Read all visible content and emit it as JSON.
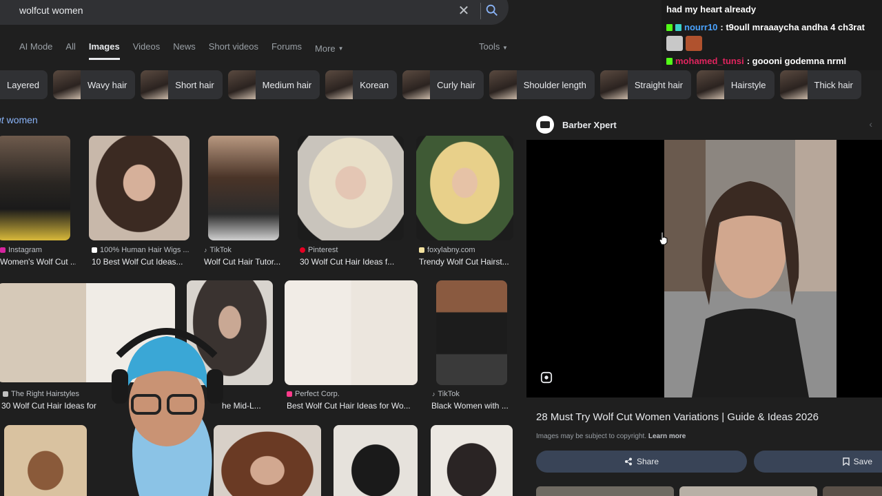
{
  "search": {
    "query": "wolfcut women"
  },
  "tabs": [
    {
      "label": "AI Mode"
    },
    {
      "label": "All"
    },
    {
      "label": "Images",
      "active": true
    },
    {
      "label": "Videos"
    },
    {
      "label": "News"
    },
    {
      "label": "Short videos"
    },
    {
      "label": "Forums"
    },
    {
      "label": "More"
    }
  ],
  "tools_label": "Tools",
  "chips": [
    "Layered",
    "Wavy hair",
    "Short hair",
    "Medium hair",
    "Korean",
    "Curly hair",
    "Shoulder length",
    "Straight hair",
    "Hairstyle",
    "Thick hair"
  ],
  "section": {
    "prefix": "ut",
    "suffix": " women"
  },
  "results_row1": [
    {
      "source": "Instagram",
      "caption": "Women's Wolf Cut ...",
      "fav": "#d6249f"
    },
    {
      "source": "100% Human Hair Wigs ...",
      "caption": "10 Best Wolf Cut Ideas...",
      "fav": "#ffffff"
    },
    {
      "source": "TikTok",
      "caption": "Wolf Cut Hair Tutor...",
      "fav": "#ffffff"
    },
    {
      "source": "Pinterest",
      "caption": "30 Wolf Cut Hair Ideas f...",
      "fav": "#e60023"
    },
    {
      "source": "foxylabny.com",
      "caption": "Trendy Wolf Cut Hairst...",
      "fav": "#f4e2a0"
    }
  ],
  "results_row2": [
    {
      "source": "The Right Hairstyles",
      "caption": "30 Wolf Cut Hair Ideas for",
      "fav": "#c0c0c0"
    },
    {
      "source": "",
      "caption": "he Mid-L...",
      "fav": ""
    },
    {
      "source": "Perfect Corp.",
      "caption": "Best Wolf Cut Hair Ideas for Wo...",
      "fav": "#ff3b8b"
    },
    {
      "source": "TikTok",
      "caption": "Black Women with ...",
      "fav": "#ffffff"
    }
  ],
  "panel": {
    "site": "Barber Xpert",
    "title": "28 Must Try Wolf Cut Women Variations | Guide & Ideas 2026",
    "copyright": "Images may be subject to copyright.",
    "learn_more": "Learn more",
    "share_label": "Share",
    "save_label": "Save"
  },
  "chat": {
    "line0": "had my heart already",
    "line1_user": "nourr10",
    "line1_msg": ": t9oull mraaaycha andha 4 ch3rat",
    "line2_user": "mohamed_tunsi",
    "line2_msg": ": goooni godemna nrml",
    "user1_color": "#4aa3ff",
    "user2_color": "#e0245e"
  }
}
